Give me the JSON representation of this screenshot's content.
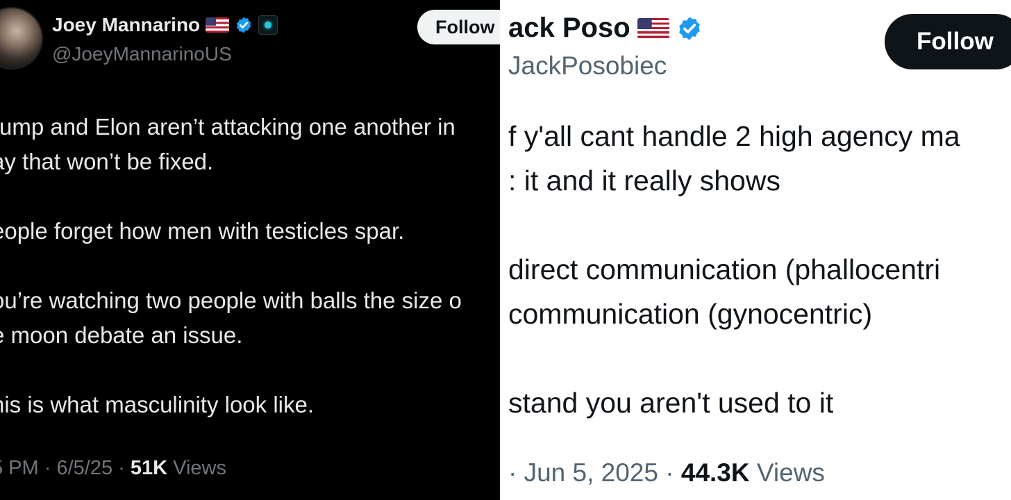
{
  "left_tweet": {
    "author_name": "Joey Mannarino",
    "handle": "@JoeyMannarinoUS",
    "follow_label": "Follow",
    "flag_icon": "us-flag-icon",
    "verified_color": "#1d9bf0",
    "lines": [
      "rump and Elon aren’t attacking one another in",
      "ay that won’t be fixed.",
      "eople forget how men with testicles spar.",
      "ou’re watching two people with balls the size o",
      "e moon debate an issue.",
      "his is what masculinity look like."
    ],
    "timestamp": "5 PM · 6/5/25 · ",
    "views_count": "51K",
    "views_label": " Views"
  },
  "right_tweet": {
    "author_name": "ack Poso",
    "handle": "JackPosobiec",
    "follow_label": "Follow",
    "flag_icon": "us-flag-icon",
    "verified_color": "#1d9bf0",
    "lines": [
      "f y'all cant handle 2 high agency ma",
      ": it and it really shows",
      "direct communication (phallocentri",
      " communication (gynocentric)",
      "stand you aren't used to it"
    ],
    "timestamp": "· Jun 5, 2025 · ",
    "views_count": "44.3K",
    "views_label": " Views"
  }
}
